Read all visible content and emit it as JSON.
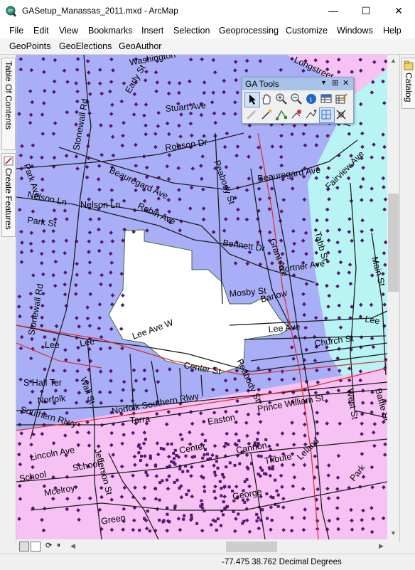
{
  "window": {
    "title": "GASetup_Manassas_2011.mxd - ArcMap",
    "controls": {
      "minimize": "—",
      "maximize": "☐",
      "close": "✕"
    }
  },
  "menu": [
    "File",
    "Edit",
    "View",
    "Bookmarks",
    "Insert",
    "Selection",
    "Geoprocessing",
    "Customize",
    "Windows",
    "Help"
  ],
  "toolbar": [
    "GeoPoints",
    "GeoElections",
    "GeoAuthor"
  ],
  "left_dock": {
    "tabs": [
      "Table Of Contents",
      "Create Features"
    ]
  },
  "right_dock": {
    "tabs": [
      "Catalog"
    ]
  },
  "ga_tools": {
    "title": "GA Tools",
    "close": "✕",
    "row1_icons": [
      "select-arrow-icon",
      "pan-hand-icon",
      "zoom-in-icon",
      "zoom-out-icon",
      "identify-icon",
      "table-icon",
      "edit-table-icon"
    ],
    "row2_icons": [
      "pencil-icon",
      "draw-line-icon",
      "vertex-icon",
      "add-point-icon",
      "flag-line-icon",
      "grid-icon",
      "cross-snap-icon"
    ]
  },
  "map": {
    "colors": {
      "blue_area": "#a9aff7",
      "pink_area": "#f6c1f3",
      "cyan_area": "#b9f4f4",
      "white_area": "#ffffff",
      "points": "#55166e",
      "roads": "#1c1c1c",
      "boundary": "#e02a2a"
    },
    "street_labels": [
      "Washington",
      "Stuart Ave",
      "Early St",
      "Stonewall Rd",
      "Park Ave",
      "Robson Dr",
      "Beauregard Ave",
      "Nelson Ln",
      "Nelson Ln",
      "Robin Ave",
      "Peabody St",
      "Beauregard Ave",
      "Park St",
      "Grant Ave",
      "Bennett Dr",
      "Portner Ave",
      "Mosby St",
      "Barlow",
      "Stonewall Rd",
      "Lee",
      "Lee",
      "Lee Ave W",
      "Lee Ave",
      "Church St",
      "Peabody St",
      "Center St",
      "Wall St",
      "S Hall Ter",
      "Norfolk",
      "Southern Rlwy",
      "Norfolk Southern Rlwy",
      "Prince William St",
      "Tarra",
      "Jefferson St",
      "Lincoln Ave",
      "School",
      "School",
      "Mcelroy",
      "Cannon",
      "Tribute",
      "George",
      "Green",
      "West St",
      "Battle St",
      "Main St",
      "Longstreet",
      "Fairview Ave",
      "Tabb St",
      "Lee",
      "Park",
      "Leland",
      "Center",
      "Easton"
    ]
  },
  "status": {
    "coordinates": "-77.475  38.762 Decimal Degrees"
  }
}
